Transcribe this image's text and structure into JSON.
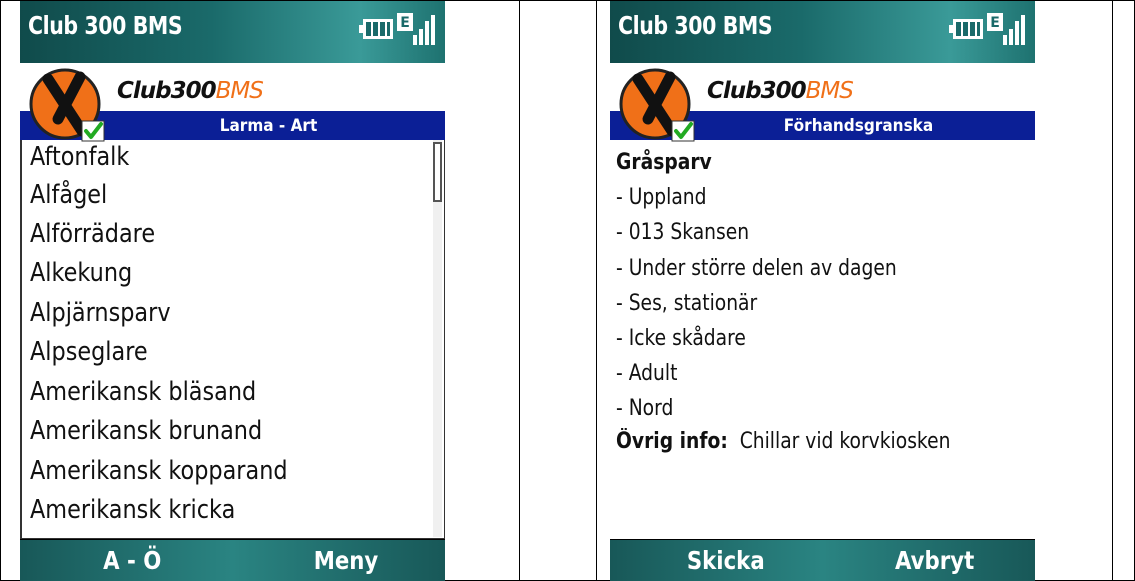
{
  "left_screen": {
    "title": "Club 300 BMS",
    "logo": {
      "club": "Club300",
      "bms": "BMS"
    },
    "section_title": "Larma - Art",
    "list_items": [
      "Aftonfalk",
      "Alfågel",
      "Alförrädare",
      "Alkekung",
      "Alpjärnsparv",
      "Alpseglare",
      "Amerikansk bläsand",
      "Amerikansk brunand",
      "Amerikansk kopparand",
      "Amerikansk kricka"
    ],
    "softkeys": {
      "left": "A - Ö",
      "right": "Meny"
    }
  },
  "right_screen": {
    "title": "Club 300 BMS",
    "logo": {
      "club": "Club300",
      "bms": "BMS"
    },
    "section_title": "Förhandsgranska",
    "species": "Gråsparv",
    "details": [
      "- Uppland",
      "- 013 Skansen",
      "- Under större delen av dagen",
      "- Ses, stationär",
      "- Icke skådare",
      "- Adult",
      "- Nord"
    ],
    "other_info_label": "Övrig info:",
    "other_info_value": "Chillar vid korvkiosken",
    "softkeys": {
      "left": "Skicka",
      "right": "Avbryt"
    }
  },
  "status": {
    "network_letter": "E"
  },
  "icons": {
    "battery": "battery-icon",
    "signal": "signal-strength-icon",
    "network": "edge-network-icon",
    "logo": "club300-logo-icon",
    "check": "checkmark-icon"
  },
  "colors": {
    "title_bar": "#1a6a6a",
    "section_bar": "#0b1f96",
    "logo_orange": "#f07018",
    "check_green": "#22aa22"
  }
}
